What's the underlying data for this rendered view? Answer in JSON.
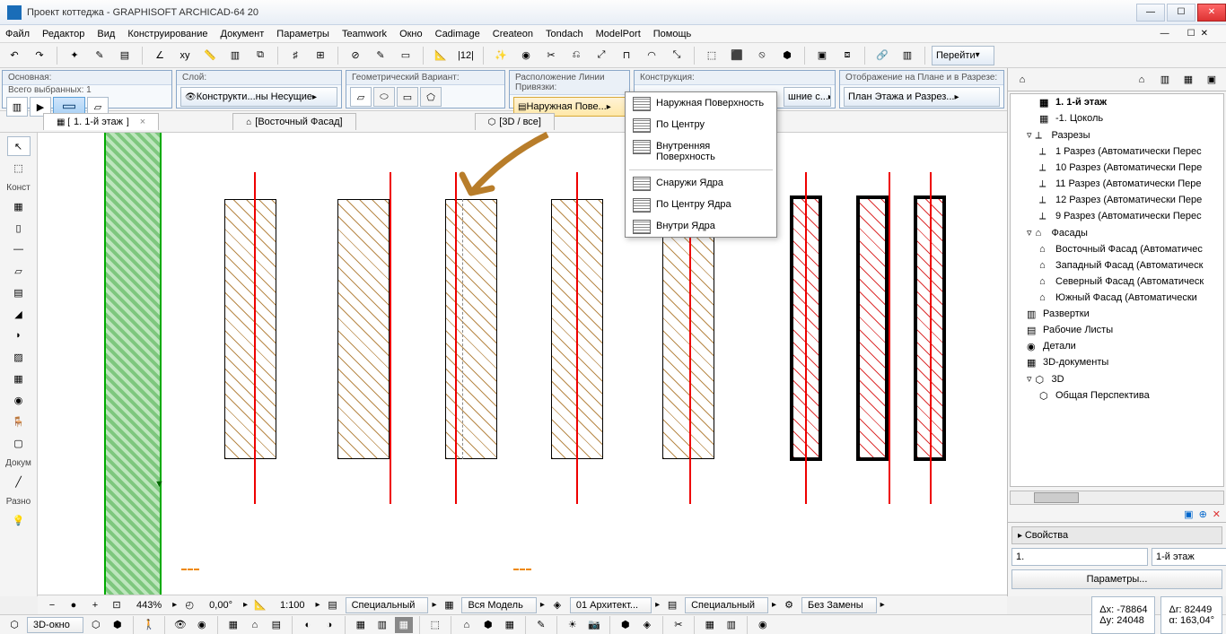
{
  "titlebar": {
    "title": "Проект коттеджа - GRAPHISOFT ARCHICAD-64 20"
  },
  "menu": [
    "Файл",
    "Редактор",
    "Вид",
    "Конструирование",
    "Документ",
    "Параметры",
    "Teamwork",
    "Окно",
    "Cadimage",
    "Createon",
    "Tondach",
    "ModelPort",
    "Помощь"
  ],
  "toolbar_right": {
    "goto": "Перейти"
  },
  "info": {
    "main": {
      "label": "Основная:",
      "selected_label": "Всего выбранных: 1"
    },
    "layer": {
      "label": "Слой:",
      "value": "Конструкти...ны Несущие"
    },
    "geom": {
      "label": "Геометрический Вариант:"
    },
    "refline": {
      "label": "Расположение Линии Привязки:",
      "value": "Наружная Пове..."
    },
    "struct": {
      "label": "Конструкция:",
      "value": "шние с..."
    },
    "display": {
      "label": "Отображение на Плане и в Разрезе:",
      "value": "План Этажа и Разрез..."
    }
  },
  "tabs": [
    {
      "label": "1. 1-й этаж"
    },
    {
      "label": "[Восточный Фасад]"
    },
    {
      "label": "[3D / все]"
    }
  ],
  "popup": {
    "group1": [
      "Наружная Поверхность",
      "По Центру",
      "Внутренняя Поверхность"
    ],
    "group2": [
      "Снаружи Ядра",
      "По Центру Ядра",
      "Внутри Ядра"
    ]
  },
  "leftbar": {
    "section1": "Конст",
    "section2": "Докум",
    "section3": "Разно"
  },
  "tree": [
    {
      "d": 2,
      "bold": true,
      "label": "1. 1-й этаж"
    },
    {
      "d": 2,
      "label": "-1. Цоколь"
    },
    {
      "d": 1,
      "exp": true,
      "label": "Разрезы"
    },
    {
      "d": 2,
      "label": "1 Разрез (Автоматически Перес"
    },
    {
      "d": 2,
      "label": "10 Разрез (Автоматически Пере"
    },
    {
      "d": 2,
      "label": "11 Разрез (Автоматически Пере"
    },
    {
      "d": 2,
      "label": "12 Разрез (Автоматически Пере"
    },
    {
      "d": 2,
      "label": "9 Разрез (Автоматически Перес"
    },
    {
      "d": 1,
      "exp": true,
      "label": "Фасады"
    },
    {
      "d": 2,
      "label": "Восточный Фасад (Автоматичес"
    },
    {
      "d": 2,
      "label": "Западный Фасад (Автоматическ"
    },
    {
      "d": 2,
      "label": "Северный Фасад (Автоматическ"
    },
    {
      "d": 2,
      "label": "Южный Фасад (Автоматически"
    },
    {
      "d": 1,
      "label": "Развертки"
    },
    {
      "d": 1,
      "label": "Рабочие Листы"
    },
    {
      "d": 1,
      "label": "Детали"
    },
    {
      "d": 1,
      "label": "3D-документы"
    },
    {
      "d": 1,
      "exp": true,
      "label": "3D"
    },
    {
      "d": 2,
      "label": "Общая Перспектива"
    }
  ],
  "props": {
    "header": "Свойства",
    "id": "1.",
    "name": "1-й этаж",
    "params_btn": "Параметры..."
  },
  "status1": {
    "zoom": "443%",
    "angle": "0,00°",
    "scale": "1:100",
    "pen": "Специальный",
    "model": "Вся Модель",
    "arch": "01 Архитект...",
    "override": "Специальный",
    "sub": "Без Замены"
  },
  "status2": {
    "view3d": "3D-окно"
  },
  "coords": {
    "dx": "Δx: -78864",
    "dy": "Δy: 24048",
    "dr": "Δr: 82449",
    "da": "α: 163,04°"
  }
}
